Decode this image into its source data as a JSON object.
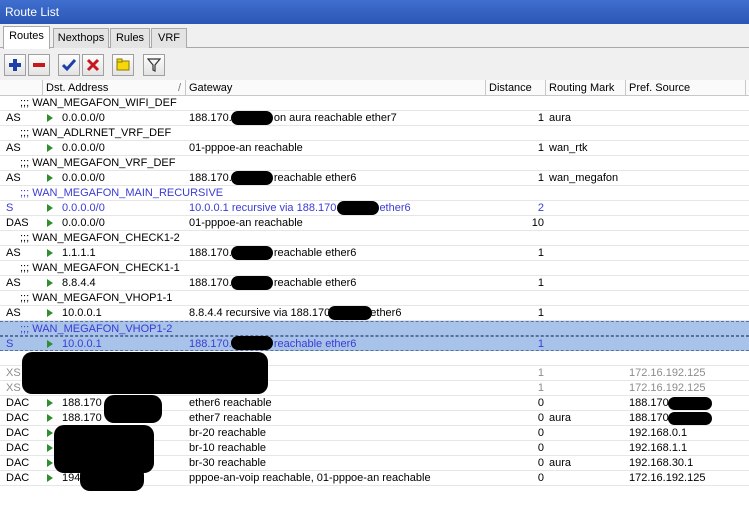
{
  "window": {
    "title": "Route List"
  },
  "tabs": [
    {
      "label": "Routes",
      "active": true
    },
    {
      "label": "Nexthops",
      "active": false
    },
    {
      "label": "Rules",
      "active": false
    },
    {
      "label": "VRF",
      "active": false
    }
  ],
  "toolbar": {
    "buttons": [
      {
        "name": "add-button",
        "icon": "plus-icon",
        "color": "#1e3ea8"
      },
      {
        "name": "remove-button",
        "icon": "minus-icon",
        "color": "#c8181e"
      },
      {
        "name": "enable-button",
        "icon": "check-icon",
        "color": "#1e3ea8"
      },
      {
        "name": "disable-button",
        "icon": "x-icon",
        "color": "#c8181e"
      },
      {
        "name": "comment-button",
        "icon": "note-icon",
        "color": "#f5d70a"
      },
      {
        "name": "filter-button",
        "icon": "filter-icon",
        "color": "#333333"
      }
    ]
  },
  "columns": {
    "flags": "",
    "dst": "Dst. Address",
    "sort_indicator": "/",
    "gateway": "Gateway",
    "distance": "Distance",
    "routing_mark": "Routing Mark",
    "pref_source": "Pref. Source"
  },
  "rows": [
    {
      "type": "group",
      "text": ";;; WAN_MEGAFON_WIFI_DEF"
    },
    {
      "type": "route",
      "flags": "AS",
      "dst": "0.0.0.0/0",
      "gateway": "188.170.",
      "gateway_tail": "on aura reachable ether7",
      "distance": "1",
      "mark": "aura",
      "pref": ""
    },
    {
      "type": "group",
      "text": ";;; WAN_ADLRNET_VRF_DEF"
    },
    {
      "type": "route",
      "flags": "AS",
      "dst": "0.0.0.0/0",
      "gateway": "01-pppoe-an reachable",
      "gateway_tail": "",
      "distance": "1",
      "mark": "wan_rtk",
      "pref": ""
    },
    {
      "type": "group",
      "text": ";;; WAN_MEGAFON_VRF_DEF"
    },
    {
      "type": "route",
      "flags": "AS",
      "dst": "0.0.0.0/0",
      "gateway": "188.170.",
      "gateway_tail": "reachable ether6",
      "distance": "1",
      "mark": "wan_megafon",
      "pref": ""
    },
    {
      "type": "group",
      "style": "blue",
      "text": ";;; WAN_MEGAFON_MAIN_RECURSIVE"
    },
    {
      "type": "route",
      "style": "blue",
      "flags": "S",
      "dst": "0.0.0.0/0",
      "gateway": "10.0.0.1 recursive via 188.170.",
      "gateway_tail": "ether6",
      "distance": "2",
      "mark": "",
      "pref": ""
    },
    {
      "type": "route",
      "flags": "DAS",
      "dst": "0.0.0.0/0",
      "gateway": "01-pppoe-an reachable",
      "gateway_tail": "",
      "distance": "10",
      "mark": "",
      "pref": ""
    },
    {
      "type": "group",
      "text": ";;; WAN_MEGAFON_CHECK1-2"
    },
    {
      "type": "route",
      "flags": "AS",
      "dst": "1.1.1.1",
      "gateway": "188.170.",
      "gateway_tail": "reachable ether6",
      "distance": "1",
      "mark": "",
      "pref": ""
    },
    {
      "type": "group",
      "text": ";;; WAN_MEGAFON_CHECK1-1"
    },
    {
      "type": "route",
      "flags": "AS",
      "dst": "8.8.4.4",
      "gateway": "188.170.",
      "gateway_tail": "reachable ether6",
      "distance": "1",
      "mark": "",
      "pref": ""
    },
    {
      "type": "group",
      "text": ";;; WAN_MEGAFON_VHOP1-1"
    },
    {
      "type": "route",
      "flags": "AS",
      "dst": "10.0.0.1",
      "gateway": "8.8.4.4 recursive via 188.170",
      "gateway_tail": "ether6",
      "distance": "1",
      "mark": "",
      "pref": ""
    },
    {
      "type": "group",
      "style": "selected blue",
      "text": ";;; WAN_MEGAFON_VHOP1-2"
    },
    {
      "type": "route",
      "style": "selected blue",
      "flags": "S",
      "dst": "10.0.0.1",
      "gateway": "188.170.",
      "gateway_tail": "reachable ether6",
      "distance": "1",
      "mark": "",
      "pref": ""
    },
    {
      "type": "group",
      "style": "gray",
      "text": ""
    },
    {
      "type": "route",
      "style": "gray",
      "flags": "XS",
      "dst": "",
      "gateway": "",
      "gateway_tail": "",
      "distance": "1",
      "mark": "",
      "pref": "172.16.192.125"
    },
    {
      "type": "route",
      "style": "gray",
      "flags": "XS",
      "dst": "",
      "gateway": "",
      "gateway_tail": "",
      "distance": "1",
      "mark": "",
      "pref": "172.16.192.125"
    },
    {
      "type": "route",
      "flags": "DAC",
      "dst": "188.170",
      "gateway": "ether6 reachable",
      "gateway_tail": "",
      "distance": "0",
      "mark": "",
      "pref": "188.170."
    },
    {
      "type": "route",
      "flags": "DAC",
      "dst": "188.170",
      "gateway": "ether7 reachable",
      "gateway_tail": "",
      "distance": "0",
      "mark": "aura",
      "pref": "188.170"
    },
    {
      "type": "route",
      "flags": "DAC",
      "dst": "",
      "gateway": "br-20 reachable",
      "gateway_tail": "",
      "distance": "0",
      "mark": "",
      "pref": "192.168.0.1"
    },
    {
      "type": "route",
      "flags": "DAC",
      "dst": "",
      "gateway": "br-10 reachable",
      "gateway_tail": "",
      "distance": "0",
      "mark": "",
      "pref": "192.168.1.1"
    },
    {
      "type": "route",
      "flags": "DAC",
      "dst": "",
      "gateway": "br-30 reachable",
      "gateway_tail": "",
      "distance": "0",
      "mark": "aura",
      "pref": "192.168.30.1"
    },
    {
      "type": "route",
      "flags": "DAC",
      "dst": "194",
      "gateway": "pppoe-an-voip reachable, 01-pppoe-an reachable",
      "gateway_tail": "",
      "distance": "0",
      "mark": "",
      "pref": "172.16.192.125"
    }
  ]
}
